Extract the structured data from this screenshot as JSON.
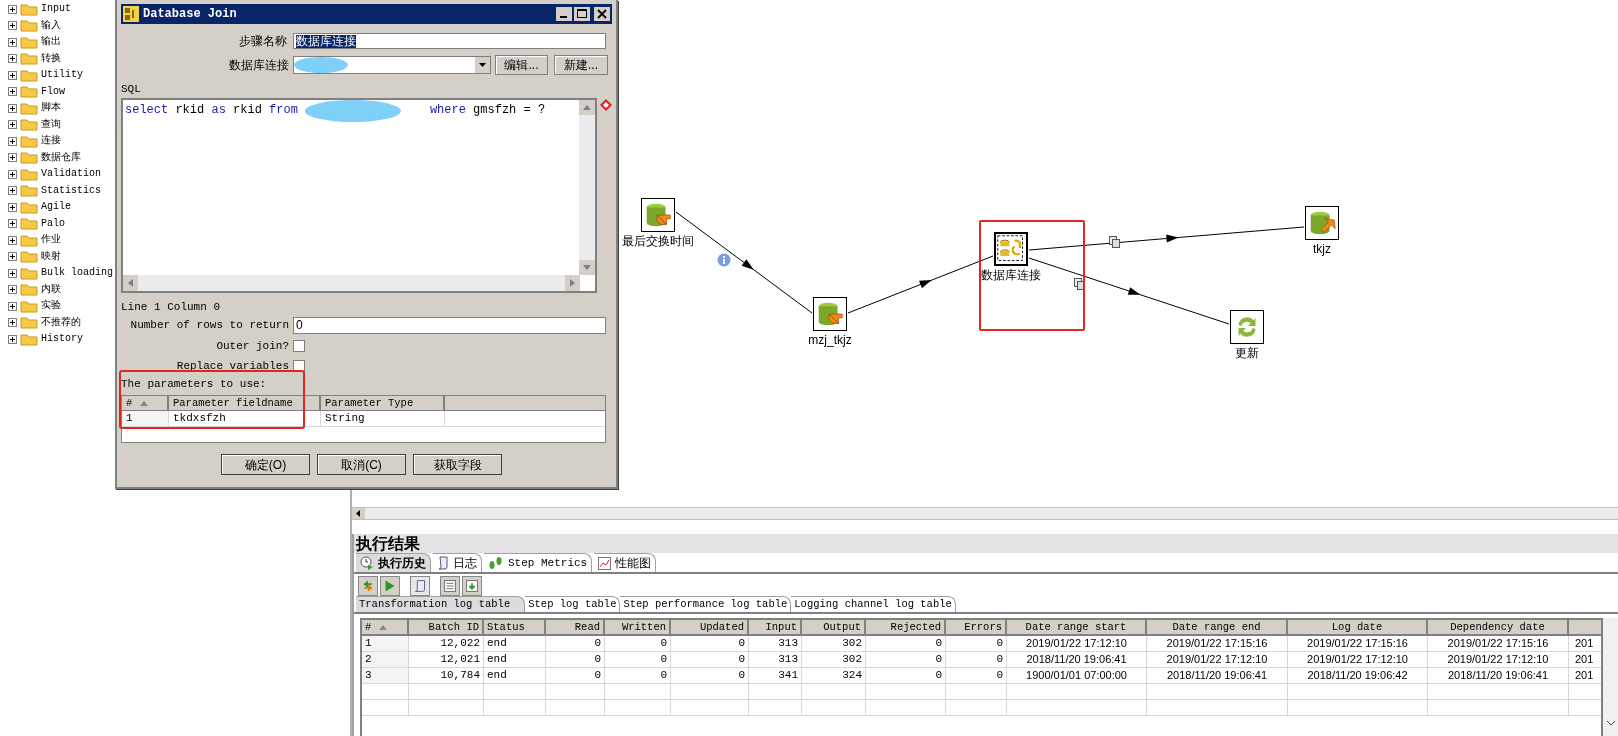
{
  "palette_tree": {
    "items": [
      {
        "label": "Input",
        "expanded": false
      },
      {
        "label": "输入",
        "expanded": false
      },
      {
        "label": "输出",
        "expanded": false
      },
      {
        "label": "转换",
        "expanded": false
      },
      {
        "label": "Utility",
        "expanded": false
      },
      {
        "label": "Flow",
        "expanded": false
      },
      {
        "label": "脚本",
        "expanded": false
      },
      {
        "label": "查询",
        "expanded": false
      },
      {
        "label": "连接",
        "expanded": false
      },
      {
        "label": "数据仓库",
        "expanded": false
      },
      {
        "label": "Validation",
        "expanded": false
      },
      {
        "label": "Statistics",
        "expanded": false
      },
      {
        "label": "Agile",
        "expanded": false
      },
      {
        "label": "Palo",
        "expanded": false
      },
      {
        "label": "作业",
        "expanded": false
      },
      {
        "label": "映射",
        "expanded": false
      },
      {
        "label": "Bulk loading",
        "expanded": false
      },
      {
        "label": "内联",
        "expanded": false
      },
      {
        "label": "实验",
        "expanded": false
      },
      {
        "label": "不推荐的",
        "expanded": false
      },
      {
        "label": "History",
        "expanded": false
      }
    ]
  },
  "dialog": {
    "title": "Database Join",
    "step_name_label": "步骤名称",
    "step_name_value": "数据库连接",
    "connection_label": "数据库连接",
    "edit_button": "编辑...",
    "new_button": "新建...",
    "sql_label": "SQL",
    "sql_parts": [
      [
        {
          "text": "select",
          "kind": "keyword"
        },
        {
          "text": " rkid ",
          "kind": "plain"
        },
        {
          "text": "as",
          "kind": "keyword"
        },
        {
          "text": " rkid ",
          "kind": "plain"
        },
        {
          "text": "from",
          "kind": "keyword"
        }
      ],
      [
        {
          "text": "where",
          "kind": "keyword"
        },
        {
          "text": " gmsfzh = ?",
          "kind": "plain"
        }
      ]
    ],
    "cursor_status": "Line 1 Column 0",
    "rows_label": "Number of rows to return",
    "rows_value": "0",
    "outer_join": {
      "label": "Outer join?",
      "checked": false
    },
    "replace_variables": {
      "label": "Replace variables",
      "checked": false
    },
    "params_label": "The parameters to use:",
    "params_columns": [
      "#",
      "Parameter fieldname",
      "Parameter Type"
    ],
    "params_rows": [
      [
        "1",
        "tkdxsfzh",
        "String"
      ]
    ],
    "buttons": [
      "确定(O)",
      "取消(C)",
      "获取字段"
    ]
  },
  "canvas": {
    "nodes": [
      {
        "label": "最后交换时间",
        "kind": "input"
      },
      {
        "label": "mzj_tkjz",
        "kind": "input"
      },
      {
        "label": "数据库连接",
        "kind": "join"
      },
      {
        "label": "tkjz",
        "kind": "output"
      },
      {
        "label": "更新",
        "kind": "update"
      }
    ]
  },
  "results": {
    "title": "执行结果",
    "tabs": [
      {
        "label": "执行历史",
        "selected": true,
        "kind": "history"
      },
      {
        "label": "日志",
        "selected": false,
        "kind": "log"
      },
      {
        "label": "Step Metrics",
        "selected": false,
        "kind": "metrics"
      },
      {
        "label": "性能图",
        "selected": false,
        "kind": "chart"
      }
    ],
    "subtabs": [
      {
        "label": "Transformation log table",
        "selected": true
      },
      {
        "label": "Step log table",
        "selected": false
      },
      {
        "label": "Step performance log table",
        "selected": false
      },
      {
        "label": "Logging channel log table",
        "selected": false
      }
    ],
    "columns": [
      "#",
      "Batch ID",
      "Status",
      "Read",
      "Written",
      "Updated",
      "Input",
      "Output",
      "Rejected",
      "Errors",
      "Date range start",
      "Date range end",
      "Log date",
      "Dependency date"
    ],
    "rows": [
      [
        "1",
        "12,022",
        "end",
        "0",
        "0",
        "0",
        "313",
        "302",
        "0",
        "0",
        "2019/01/22 17:12:10",
        "2019/01/22 17:15:16",
        "2019/01/22 17:15:16",
        "2019/01/22 17:15:16",
        "201"
      ],
      [
        "2",
        "12,021",
        "end",
        "0",
        "0",
        "0",
        "313",
        "302",
        "0",
        "0",
        "2018/11/20 19:06:41",
        "2019/01/22 17:12:10",
        "2019/01/22 17:12:10",
        "2019/01/22 17:12:10",
        "201"
      ],
      [
        "3",
        "10,784",
        "end",
        "0",
        "0",
        "0",
        "341",
        "324",
        "0",
        "0",
        "1900/01/01 07:00:00",
        "2018/11/20 19:06:41",
        "2018/11/20 19:06:42",
        "2018/11/20 19:06:41",
        "201"
      ]
    ]
  }
}
